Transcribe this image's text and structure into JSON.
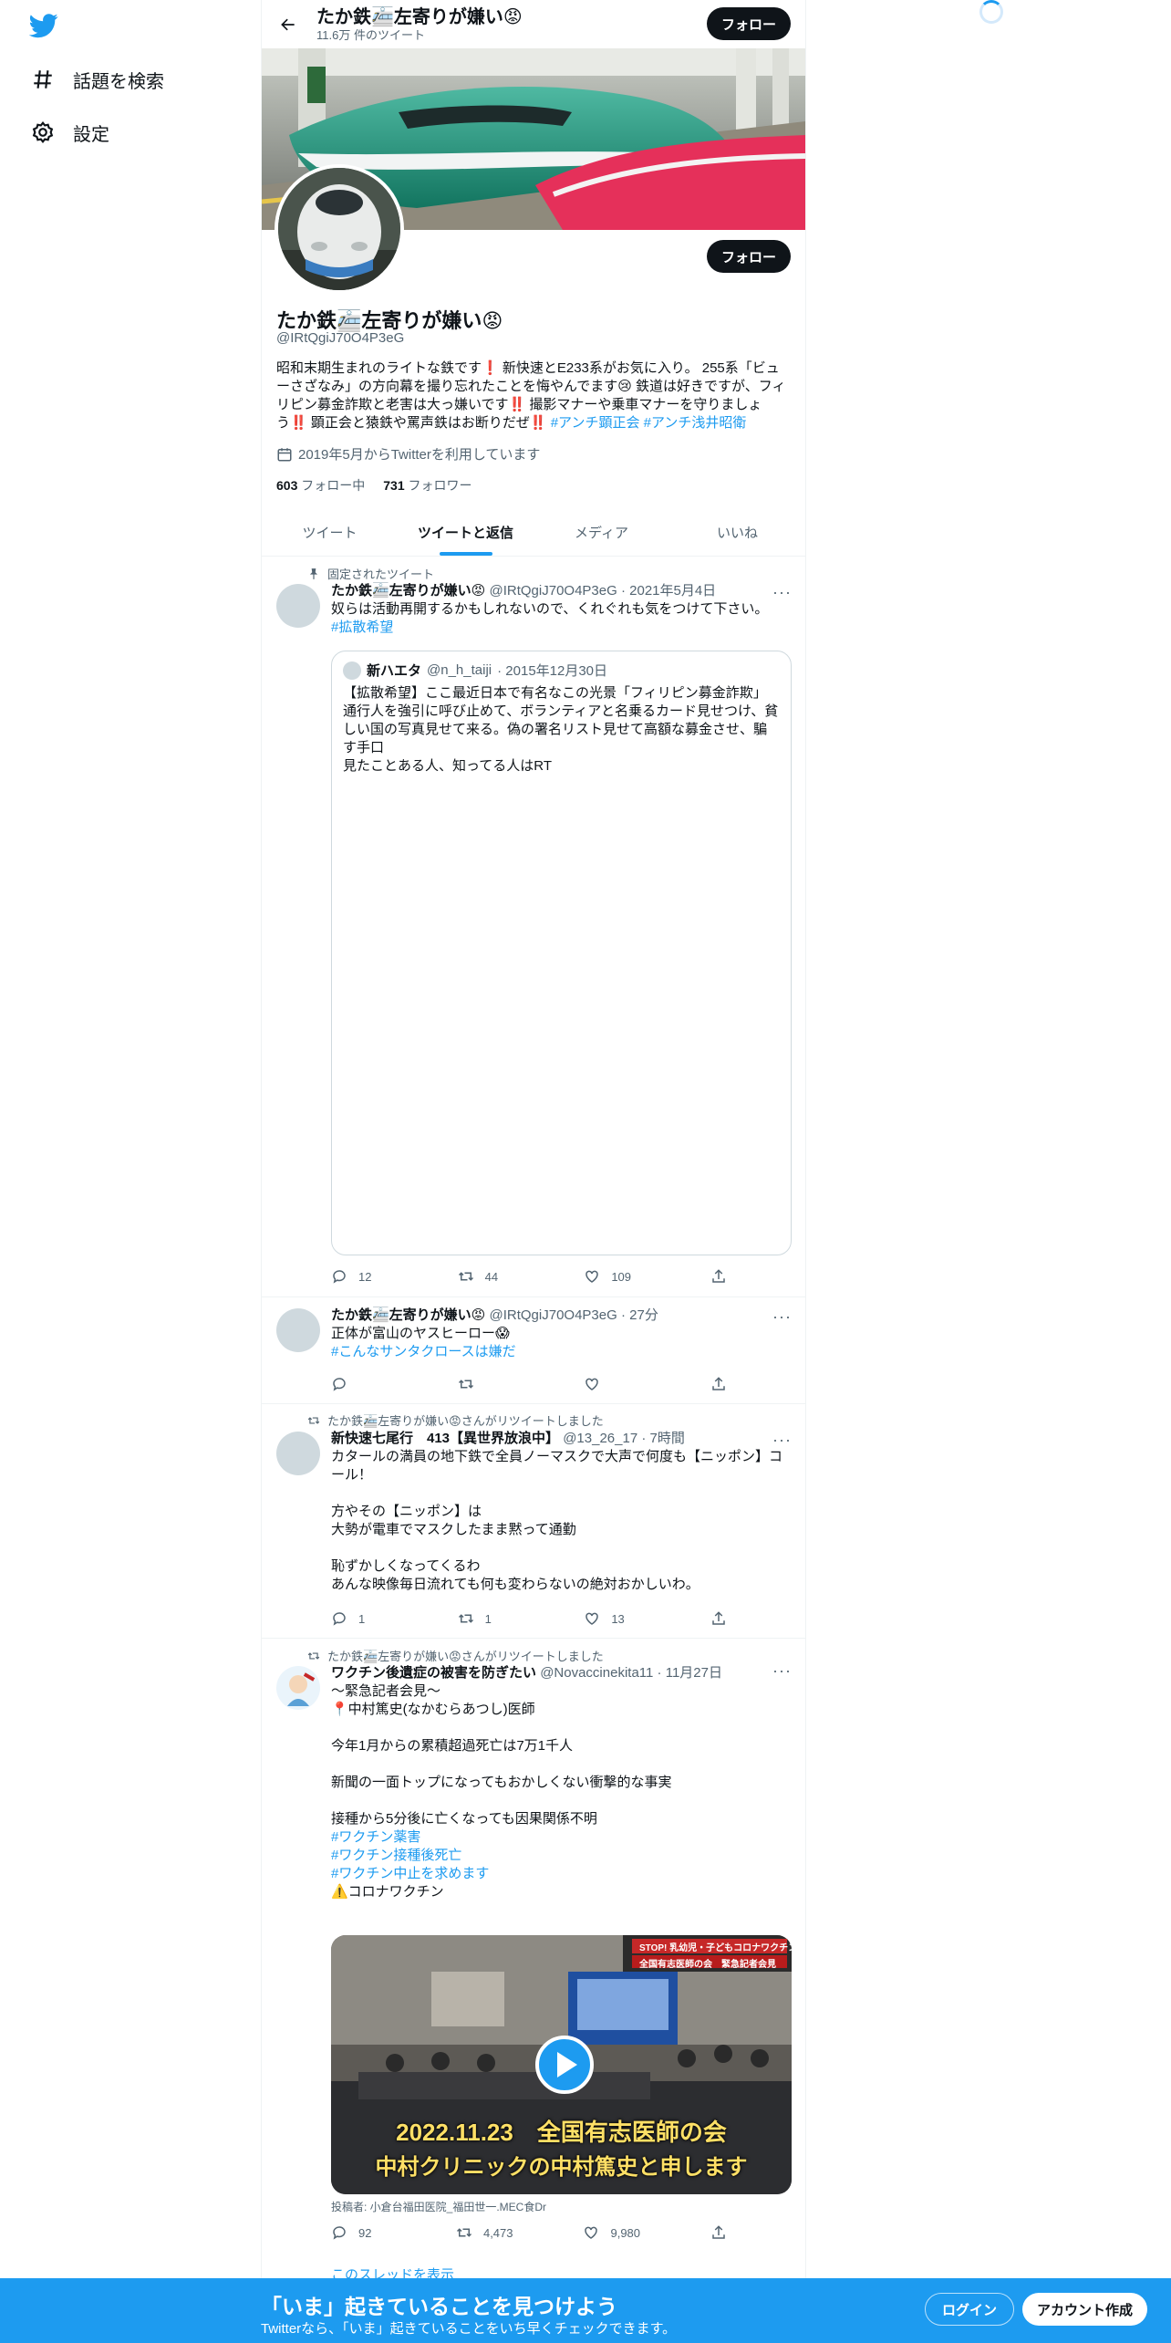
{
  "nav": {
    "items": [
      {
        "label": "話題を検索",
        "icon": "hashtag-icon"
      },
      {
        "label": "設定",
        "icon": "gear-icon"
      }
    ]
  },
  "header": {
    "name": "たか鉄🚈左寄りが嫌い😡",
    "tweet_count": "11.6万 件のツイート",
    "follow_label": "フォロー"
  },
  "profile": {
    "name": "たか鉄🚈左寄りが嫌い😡",
    "handle": "@IRtQgiJ70O4P3eG",
    "follow_label": "フォロー",
    "bio_text": "昭和末期生まれのライトな鉄です❗ 新快速とE233系がお気に入り。 255系「ビューさざなみ」の方向幕を撮り忘れたことを悔やんでます😢 鉄道は好きですが、フィリピン募金詐欺と老害は大っ嫌いです‼️ 撮影マナーや乗車マナーを守りましょう‼️ 顕正会と猿鉄や罵声鉄はお断りだぜ‼️ ",
    "bio_tags": [
      "#アンチ顕正会",
      "#アンチ浅井昭衛"
    ],
    "joined": "2019年5月からTwitterを利用しています",
    "following_count": "603",
    "following_label": "フォロー中",
    "followers_count": "731",
    "followers_label": "フォロワー"
  },
  "tabs": [
    {
      "label": "ツイート",
      "active": false
    },
    {
      "label": "ツイートと返信",
      "active": true
    },
    {
      "label": "メディア",
      "active": false
    },
    {
      "label": "いいね",
      "active": false
    }
  ],
  "tweets": [
    {
      "context": "固定されたツイート",
      "name": "たか鉄🚈左寄りが嫌い😡",
      "handle": "@IRtQgiJ70O4P3eG",
      "time": "· 2021年5月4日",
      "text": "奴らは活動再開するかもしれないので、くれぐれも気をつけて下さい。",
      "hashtag": "#拡散希望",
      "quote": {
        "name": "新ハエタ",
        "handle": "@n_h_taiji",
        "time": "· 2015年12月30日",
        "text": "【拡散希望】ここ最近日本で有名なこの光景「フィリピン募金詐欺」通行人を強引に呼び止めて、ボランティアと名乗るカード見せつけ、貧しい国の写真見せて来る。偽の署名リスト見せて高額な募金させ、騙す手口\n見たことある人、知ってる人はRT"
      },
      "stats": {
        "reply": "12",
        "retweet": "44",
        "like": "109"
      }
    },
    {
      "name": "たか鉄🚈左寄りが嫌い😡",
      "handle": "@IRtQgiJ70O4P3eG",
      "time": "· 27分",
      "text": "正体が富山のヤスヒーロー😱",
      "hashtag": "#こんなサンタクロースは嫌だ",
      "stats": {
        "reply": "",
        "retweet": "",
        "like": ""
      }
    },
    {
      "context": "たか鉄🚈左寄りが嫌い😡さんがリツイートしました",
      "name": "新快速七尾行　413【異世界放浪中】",
      "handle": "@13_26_17",
      "time": "· 7時間",
      "text": "カタールの満員の地下鉄で全員ノーマスクで大声で何度も【ニッポン】コール！\n\n方やその【ニッポン】は\n大勢が電車でマスクしたまま黙って通勤\n\n恥ずかしくなってくるわ\nあんな映像毎日流れても何も変わらないの絶対おかしいわ。",
      "stats": {
        "reply": "1",
        "retweet": "1",
        "like": "13"
      }
    },
    {
      "context": "たか鉄🚈左寄りが嫌い😡さんがリツイートしました",
      "name": "ワクチン後遺症の被害を防ぎたい",
      "handle": "@Novaccinekita11",
      "time": "· 11月27日",
      "text_before": "～緊急記者会見～\n📍中村篤史(なかむらあつし)医師\n\n今年1月からの累積超過死亡は7万1千人\n\n新聞の一面トップになってもおかしくない衝撃的な事実\n\n接種から5分後に亡くなっても因果関係不明\n",
      "hashtags": [
        "#ワクチン薬害",
        "#ワクチン接種後死亡",
        "#ワクチン中止を求めます"
      ],
      "text_after": "⚠️コロナワクチン",
      "video": {
        "banner_top": "STOP! 乳幼児・子どもコロナワクチン",
        "banner_bottom": "全国有志医師の会　緊急記者会見",
        "caption1": "2022.11.23　全国有志医師の会",
        "caption2": "中村クリニックの中村篤史と申します"
      },
      "poster": "投稿者: 小倉台福田医院_福田世一.MEC食Dr",
      "stats": {
        "reply": "92",
        "retweet": "4,473",
        "like": "9,980"
      },
      "thread_link": "このスレッドを表示"
    }
  ],
  "bottom": {
    "title": "「いま」起きていることを見つけよう",
    "subtitle": "Twitterなら、「いま」起きていることをいち早くチェックできます。",
    "login": "ログイン",
    "signup": "アカウント作成"
  },
  "colors": {
    "accent": "#1d9bf0",
    "text": "#0f1419",
    "muted": "#536471"
  }
}
